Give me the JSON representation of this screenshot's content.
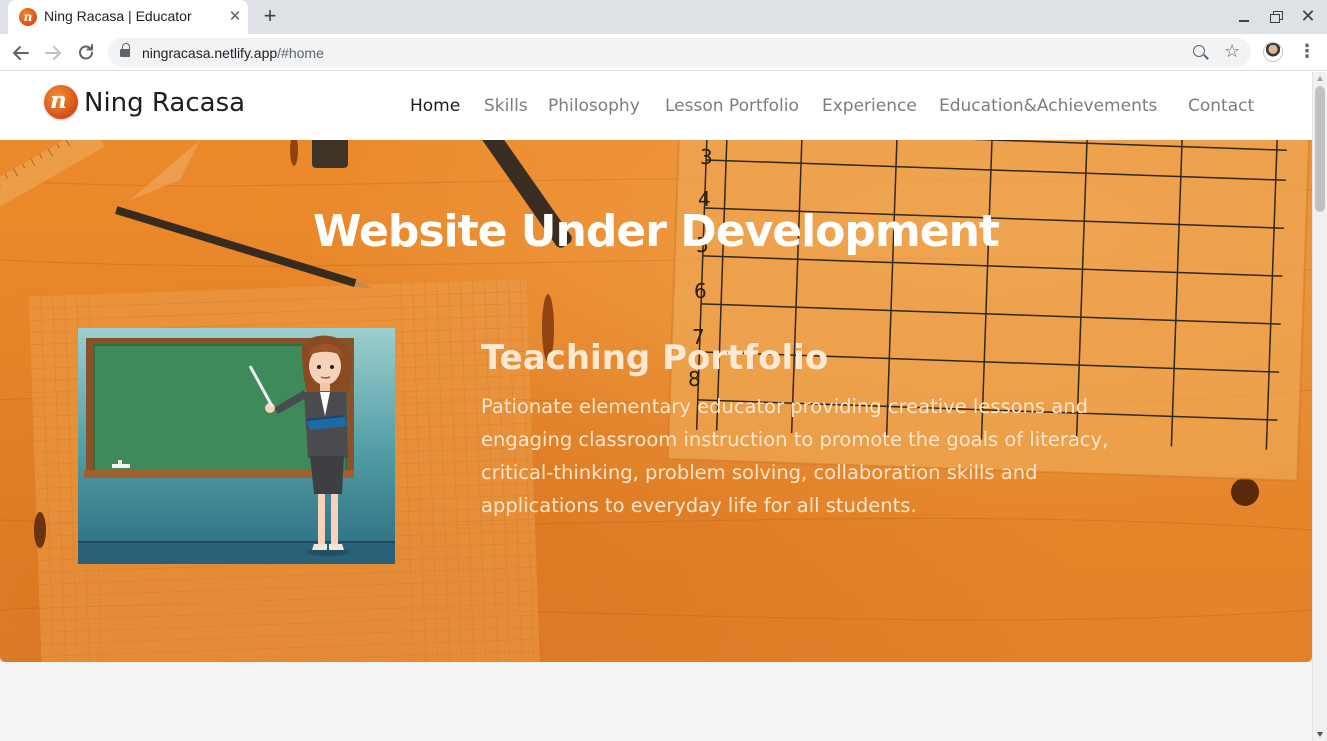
{
  "browser": {
    "tab_title": "Ning Racasa | Educator",
    "tab_favicon_letter": "n",
    "tab_close": "✕",
    "new_tab": "+",
    "url_domain": "ningracasa.netlify.app",
    "url_path": "/#home",
    "close_window": "✕"
  },
  "site": {
    "logo_letter": "n",
    "brand_name": "Ning Racasa",
    "nav": [
      {
        "label": "Home",
        "active": true
      },
      {
        "label": "Skills",
        "active": false
      },
      {
        "label": "Philosophy",
        "active": false
      },
      {
        "label": "Lesson Portfolio",
        "active": false
      },
      {
        "label": "Experience",
        "active": false
      },
      {
        "label": "Education&Achievements",
        "active": false
      },
      {
        "label": "Contact",
        "active": false
      }
    ]
  },
  "hero": {
    "title": "Website Under Development",
    "heading": "Teaching Portfolio",
    "text": "Pationate elementary educator providing creative lessons and engaging classroom instruction to promote the goals of literacy, critical-thinking, problem solving, collaboration skills and applications to everyday life for all students.",
    "chart_numbers": [
      "3",
      "4",
      "5",
      "6",
      "7",
      "8"
    ]
  },
  "colors": {
    "hero_orange": "#e7862a",
    "accent": "#d24c17",
    "chalkboard": "#3f8a5a"
  }
}
